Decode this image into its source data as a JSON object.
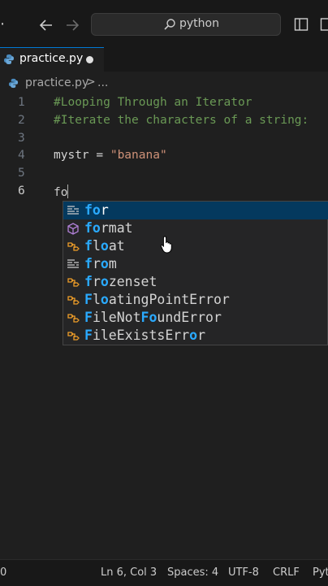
{
  "titlebar": {
    "search_text": "python"
  },
  "tab": {
    "label": "practice.py"
  },
  "breadcrumb": {
    "file": "practice.py",
    "separator": ">",
    "more": "..."
  },
  "editor": {
    "lines": [
      {
        "number": "1",
        "text": "#Looping Through an Iterator"
      },
      {
        "number": "2",
        "text": "#Iterate the characters of a string:"
      },
      {
        "number": "3",
        "text": ""
      },
      {
        "number": "4",
        "var": "mystr = ",
        "str": "\"banana\""
      },
      {
        "number": "5",
        "text": ""
      },
      {
        "number": "6",
        "text": "fo"
      }
    ]
  },
  "suggestions": [
    {
      "match": "fo",
      "rest": "r",
      "icon": "keyword-icon"
    },
    {
      "match": "fo",
      "rest": "rmat",
      "icon": "method-cube-icon"
    },
    {
      "pre": "",
      "label": "float",
      "icon": "class-icon"
    },
    {
      "label": "from",
      "icon": "keyword-icon"
    },
    {
      "label": "frozenset",
      "icon": "class-icon"
    },
    {
      "label": "FloatingPointError",
      "icon": "class-icon"
    },
    {
      "label": "FileNotFoundError",
      "icon": "class-icon"
    },
    {
      "label": "FileExistsError",
      "icon": "class-icon"
    }
  ],
  "statusbar": {
    "left": "0",
    "position": "Ln 6, Col 3",
    "spaces": "Spaces: 4",
    "encoding": "UTF-8",
    "eol": "CRLF",
    "language": "Pyt"
  },
  "colors": {
    "accent": "#0078d4",
    "match": "#2aaaff",
    "selected": "#04395e",
    "comment": "#6a9955",
    "string": "#ce9178"
  }
}
